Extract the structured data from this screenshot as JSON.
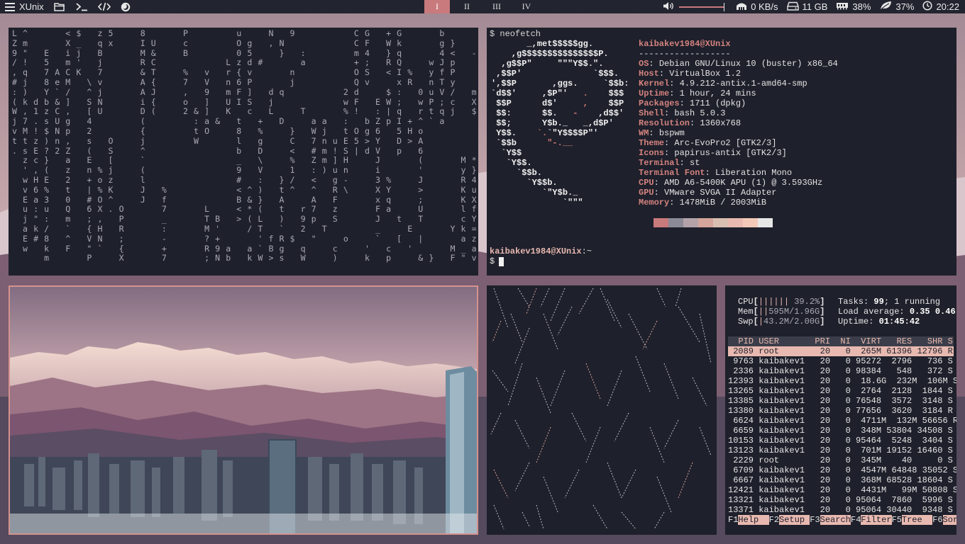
{
  "topbar": {
    "launcher_label": "XUnix",
    "workspaces": [
      "I",
      "II",
      "III",
      "IV"
    ],
    "active_workspace": 0,
    "net": "0 KB/s",
    "disk": "11 GB",
    "mem": "38%",
    "cpu": "37%",
    "clock": "20:22",
    "volume_level": 1.0
  },
  "matrix": {
    "lines": [
      "L ^       < $   z 5     8       P         u     N   9           C G   + G       b       B   S Q ?",
      "Z m       X _   q x     I U     c         O g   , N             C F   W k       g }     A   % p x",
      "9 \"   E   i j   B       M &     B         0 5     }   :         m 4   } q       4 <   -   k d +",
      "/ !   5   m '   j       R C             L z d #       a         + ;   R Q     w J p       % f f",
      ", q   7 A C K   7       & T     %   v   r { v       n           O S   < I %   y f P       8 4 q   x",
      "# j   8 e M   \\ v       A {     7   V   n 6 P       j           Q v     x R   n T y     g c ] # K J",
      ": )   Y ` /   ^ j       A J     ,   9   m F ]   d q           2 d     $ :   0 u V /   m   X b P a",
      "( k d b & ]   S N       i {     o   ]   U I S   j             w F   E W ;   w P ; c   X     O _ }",
      "W , 1 z C ,   [ U       D (     2 & ]   K   c   L     T       % !   : | q   r t q j   $       j a ,",
      "j 7 . s U g   4         (         : a &   t   +   D     a a   :   b Z p I + ^ ` a           V | > n",
      "v M ! $ N p   2         {         t O     8   %     }   W j   t O g 6   5 H o               @ ( L",
      "t t z ) n ,   s   O     j         W       l   g     C   7 n u E 5 > Y   D > A           d S E",
      ". s E ? 2 Z   (   S     ^                 b   D     <   # m ! S | d V   p   6           S ) S f",
      "  z c }   a   E   [     `                 _   \\     %   Z m ] H     J       (       M * \" ? $",
      "  ' , (   z   n % j     (                 9   V     1   : ) u n     i       '       y } h A I",
      "  w H E   2   + o z     l                 #   :   } /   <   g -     3 %     J       R 4 z X U",
      "  v 6 %   t   | % K     J   %             < ^ )   t ^   ^   R \\     X Y     >       K u o G W",
      "  E a 3   0   # O ^     J   f             B & }   A     A   F       x q     ;       K X k } b B",
      "  u : u   Q   6 X . O       7       L     < * (   t   r 7   z       F a     U       l f D I > -",
      "  j \" :   m   ; ,   P       _       T B   > ( L   )   9 p   S       J   t   T       c Y W C H P",
      "  a k /   `   { H   R       :       M '     / T   `   2   T         _     E       Y k =   R",
      "  E # 8   ^   V N   ;       -       ? +       ' f R $   \"     o     `   [   |       a z w   h",
      "  w   k   F   \" `   {       +       R 9 a   a ` B g   q     c     '   c   '       M _ a   &",
      "      m       P     X       7       ; N b   k W > s   W     )     k   p     & }   F \" v   h"
    ]
  },
  "neofetch": {
    "command": "$ neofetch",
    "user_host": "kaibakev1984@XUnix",
    "separator": "------------------",
    "info": [
      {
        "key": "OS",
        "value": "Debian GNU/Linux 10 (buster) x86_64"
      },
      {
        "key": "Host",
        "value": "VirtualBox 1.2"
      },
      {
        "key": "Kernel",
        "value": "4.9.212-antix.1-amd64-smp"
      },
      {
        "key": "Uptime",
        "value": "1 hour, 24 mins"
      },
      {
        "key": "Packages",
        "value": "1711 (dpkg)"
      },
      {
        "key": "Shell",
        "value": "bash 5.0.3"
      },
      {
        "key": "Resolution",
        "value": "1360x768"
      },
      {
        "key": "WM",
        "value": "bspwm"
      },
      {
        "key": "Theme",
        "value": "Arc-EvoPro2 [GTK2/3]"
      },
      {
        "key": "Icons",
        "value": "papirus-antix [GTK2/3]"
      },
      {
        "key": "Terminal",
        "value": "st"
      },
      {
        "key": "Terminal Font",
        "value": "Liberation Mono"
      },
      {
        "key": "CPU",
        "value": "AMD A6-5400K APU (1) @ 3.593GHz"
      },
      {
        "key": "GPU",
        "value": "VMware SVGA II Adapter"
      },
      {
        "key": "Memory",
        "value": "1478MiB / 2003MiB"
      }
    ],
    "palette": [
      "#c97a7d",
      "#8b8a96",
      "#b3a3a8",
      "#d4a59a",
      "#d8bfb2",
      "#e8b9b0",
      "#f2c9b8",
      "#e6e6e6"
    ],
    "prompt_user": "kaibakev1984@XUnix",
    "prompt_path": ":~",
    "prompt_symbol": "$"
  },
  "htop": {
    "cpu_label": "CPU",
    "cpu_bar": "||||||",
    "cpu_val": "39.2%",
    "mem_label": "Mem",
    "mem_bar": "||",
    "mem_val": "595M/1.96G",
    "swp_label": "Swp",
    "swp_bar": "|",
    "swp_val": "43.2M/2.00G",
    "tasks_label": "Tasks:",
    "tasks_val": "99",
    "tasks_rest": "; 1 running",
    "load_label": "Load average:",
    "load_val": "0.35 0.46",
    "uptime_label": "Uptime:",
    "uptime_val": "01:45:42",
    "header": "  PID USER       PRI  NI  VIRT   RES   SHR S C",
    "processes": [
      " 2089 root        20   0  265M 61396 12796 R 2",
      " 9763 kaibakev1   20   0 95272  2796   736 S",
      " 2336 kaibakev1   20   0 98384   548   372 S",
      "12393 kaibakev1   20   0  18.6G  232M  106M S",
      "13265 kaibakev1   20   0  2764  2128  1844 S",
      "13385 kaibakev1   20   0 76548  3572  3148 S",
      "13380 kaibakev1   20   0 77656  3620  3184 R",
      " 6624 kaibakev1   20   0  4711M  132M 56656 R",
      " 6659 kaibakev1   20   0  348M 53804 34508 S",
      "10153 kaibakev1   20   0 95464  5248  3404 S",
      "13123 kaibakev1   20   0  701M 19152 16460 S",
      " 2229 root        20   0  345M    40     0 S",
      " 6709 kaibakev1   20   0  4547M 64848 35052 S",
      " 6667 kaibakev1   20   0  368M 68528 18604 S",
      "12421 kaibakev1   20   0  4431M   99M 50808 S",
      "13321 kaibakev1   20   0 95064  7860  5996 S",
      "13371 kaibakev1   20   0 95064 30440  9348 S"
    ],
    "fkeys": [
      {
        "k": "F1",
        "l": "Help  "
      },
      {
        "k": "F2",
        "l": "Setup "
      },
      {
        "k": "F3",
        "l": "Search"
      },
      {
        "k": "F4",
        "l": "Filter"
      },
      {
        "k": "F5",
        "l": "Tree  "
      },
      {
        "k": "F6",
        "l": "Sor"
      }
    ]
  },
  "colors": {
    "accent": "#c97a7d",
    "panel": "#1e202b",
    "pink": "#e8b9b0"
  }
}
